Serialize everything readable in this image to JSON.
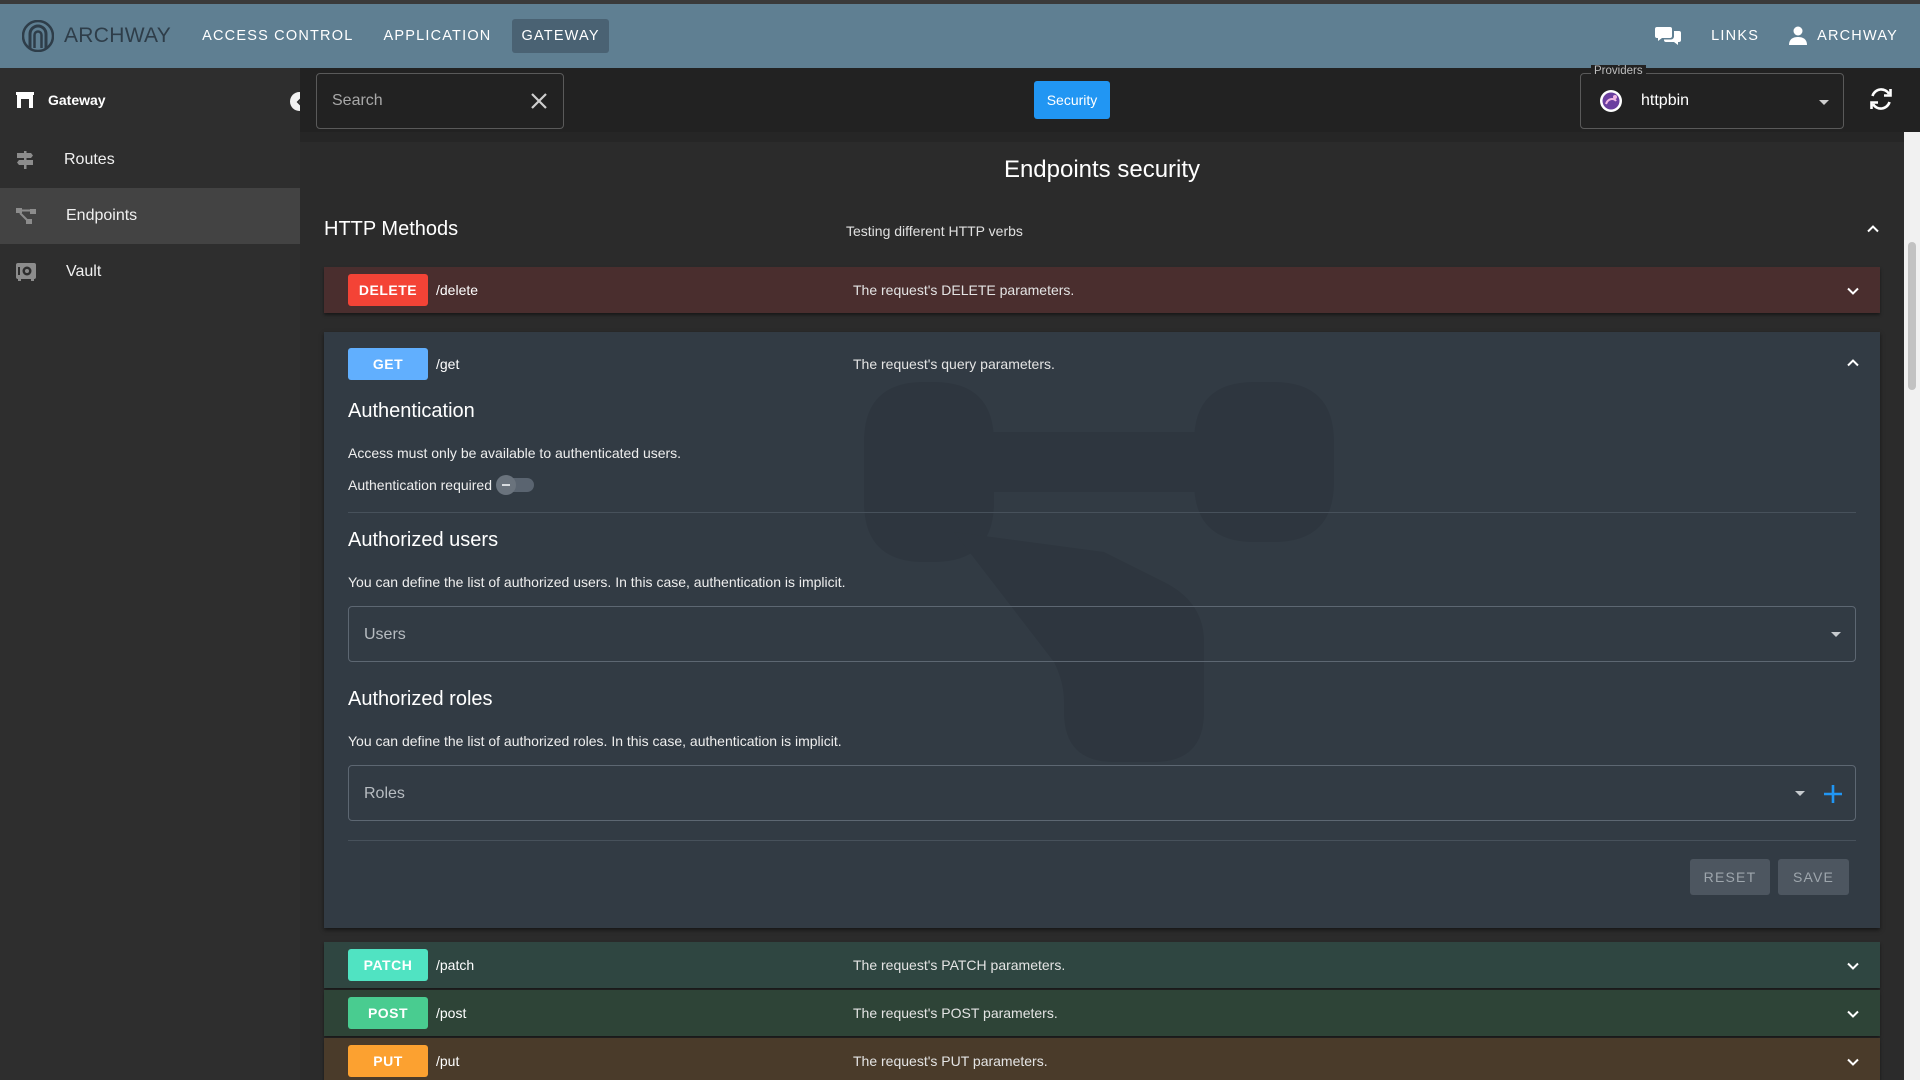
{
  "app": {
    "name": "ARCHWAY"
  },
  "nav": {
    "items": [
      {
        "label": "ACCESS CONTROL"
      },
      {
        "label": "APPLICATION"
      },
      {
        "label": "GATEWAY"
      }
    ],
    "links_label": "LINKS",
    "user_label": "ARCHWAY"
  },
  "sidebar": {
    "title": "Gateway",
    "items": [
      {
        "label": "Routes",
        "icon": "signpost-icon"
      },
      {
        "label": "Endpoints",
        "icon": "endpoints-icon"
      },
      {
        "label": "Vault",
        "icon": "vault-icon"
      }
    ]
  },
  "toolbar": {
    "search_placeholder": "Search",
    "security_label": "Security",
    "providers_label": "Providers",
    "providers_value": "httpbin"
  },
  "page": {
    "title": "Endpoints security",
    "group": {
      "title": "HTTP Methods",
      "description": "Testing different HTTP verbs"
    },
    "endpoints": [
      {
        "method": "DELETE",
        "path": "/delete",
        "description": "The request's DELETE parameters.",
        "color": "#f44336",
        "row_bg": "#4a2e2e"
      },
      {
        "method": "GET",
        "path": "/get",
        "description": "The request's query parameters.",
        "color": "#61affe",
        "row_bg": "#323b44"
      },
      {
        "method": "PATCH",
        "path": "/patch",
        "description": "The request's PATCH parameters.",
        "color": "#50e3c2",
        "row_bg": "#2f4641"
      },
      {
        "method": "POST",
        "path": "/post",
        "description": "The request's POST parameters.",
        "color": "#49cc90",
        "row_bg": "#2e4437"
      },
      {
        "method": "PUT",
        "path": "/put",
        "description": "The request's PUT parameters.",
        "color": "#fca130",
        "row_bg": "#4a3b2a"
      }
    ],
    "details": {
      "auth_title": "Authentication",
      "auth_text": "Access must only be available to authenticated users.",
      "auth_toggle_label": "Authentication required",
      "auth_required": false,
      "users_title": "Authorized users",
      "users_text": "You can define the list of authorized users. In this case, authentication is implicit.",
      "users_placeholder": "Users",
      "roles_title": "Authorized roles",
      "roles_text": "You can define the list of authorized roles. In this case, authentication is implicit.",
      "roles_placeholder": "Roles",
      "reset_label": "RESET",
      "save_label": "SAVE"
    }
  },
  "colors": {
    "appbar": "#5f7f92",
    "accent": "#2196f3"
  }
}
